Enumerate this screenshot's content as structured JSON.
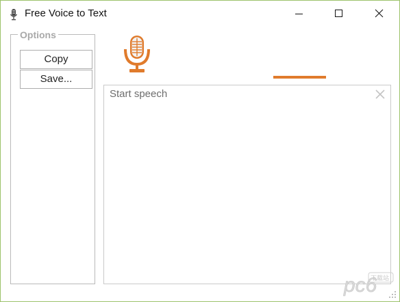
{
  "window": {
    "title": "Free Voice to Text",
    "app_icon": "microphone-icon",
    "controls": [
      "minimize-icon",
      "maximize-icon",
      "close-icon"
    ]
  },
  "options": {
    "legend": "Options",
    "copy_label": "Copy",
    "save_label": "Save..."
  },
  "mic": {
    "icon": "microphone-icon",
    "color": "#e07b2c"
  },
  "speech": {
    "placeholder": "Start speech",
    "clear_icon": "close-icon"
  },
  "watermark": {
    "brand": "pc6",
    "sub": "下载站"
  },
  "colors": {
    "accent": "#e07b2c",
    "window_border": "#9cc26a",
    "border": "#c9c9c9"
  }
}
